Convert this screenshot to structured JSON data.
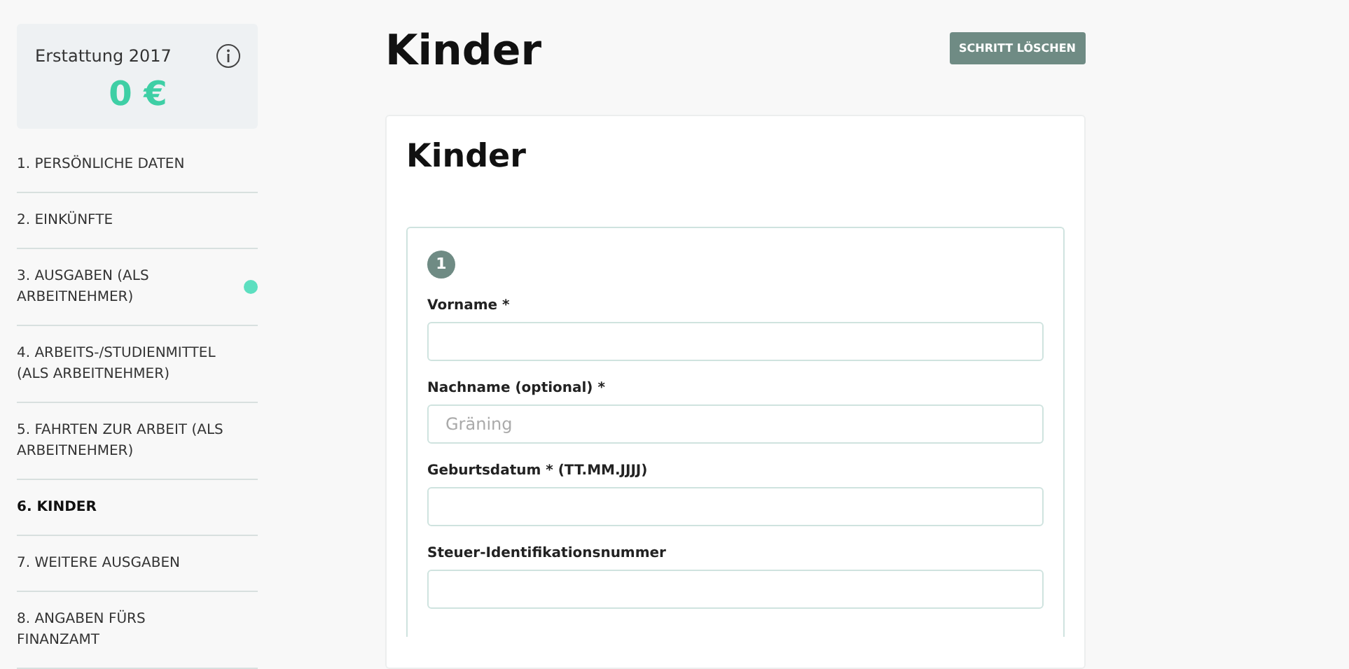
{
  "summary": {
    "title": "Erstattung 2017",
    "amount": "0 €"
  },
  "sidebar": {
    "items": [
      {
        "label": "1. PERSÖNLICHE DATEN",
        "selected": false,
        "marked": false
      },
      {
        "label": "2. EINKÜNFTE",
        "selected": false,
        "marked": false
      },
      {
        "label": "3. AUSGABEN (ALS ARBEITNEHMER)",
        "selected": false,
        "marked": true
      },
      {
        "label": "4. ARBEITS-/STUDIENMITTEL (ALS ARBEITNEHMER)",
        "selected": false,
        "marked": false
      },
      {
        "label": "5. FAHRTEN ZUR ARBEIT (ALS ARBEITNEHMER)",
        "selected": false,
        "marked": false
      },
      {
        "label": "6. KINDER",
        "selected": true,
        "marked": false
      },
      {
        "label": "7. WEITERE AUSGABEN",
        "selected": false,
        "marked": false
      },
      {
        "label": "8. ANGABEN FÜRS FINANZAMT",
        "selected": false,
        "marked": false
      }
    ]
  },
  "page": {
    "title": "Kinder",
    "delete_button": "SCHRITT LÖSCHEN"
  },
  "card": {
    "title": "Kinder",
    "child_number": "1",
    "fields": [
      {
        "label": "Vorname *"
      },
      {
        "label": "Nachname (optional) *",
        "placeholder": "Gräning"
      },
      {
        "label": "Geburtsdatum * (TT.MM.JJJJ)"
      },
      {
        "label": "Steuer-Identifikationsnummer"
      }
    ]
  }
}
